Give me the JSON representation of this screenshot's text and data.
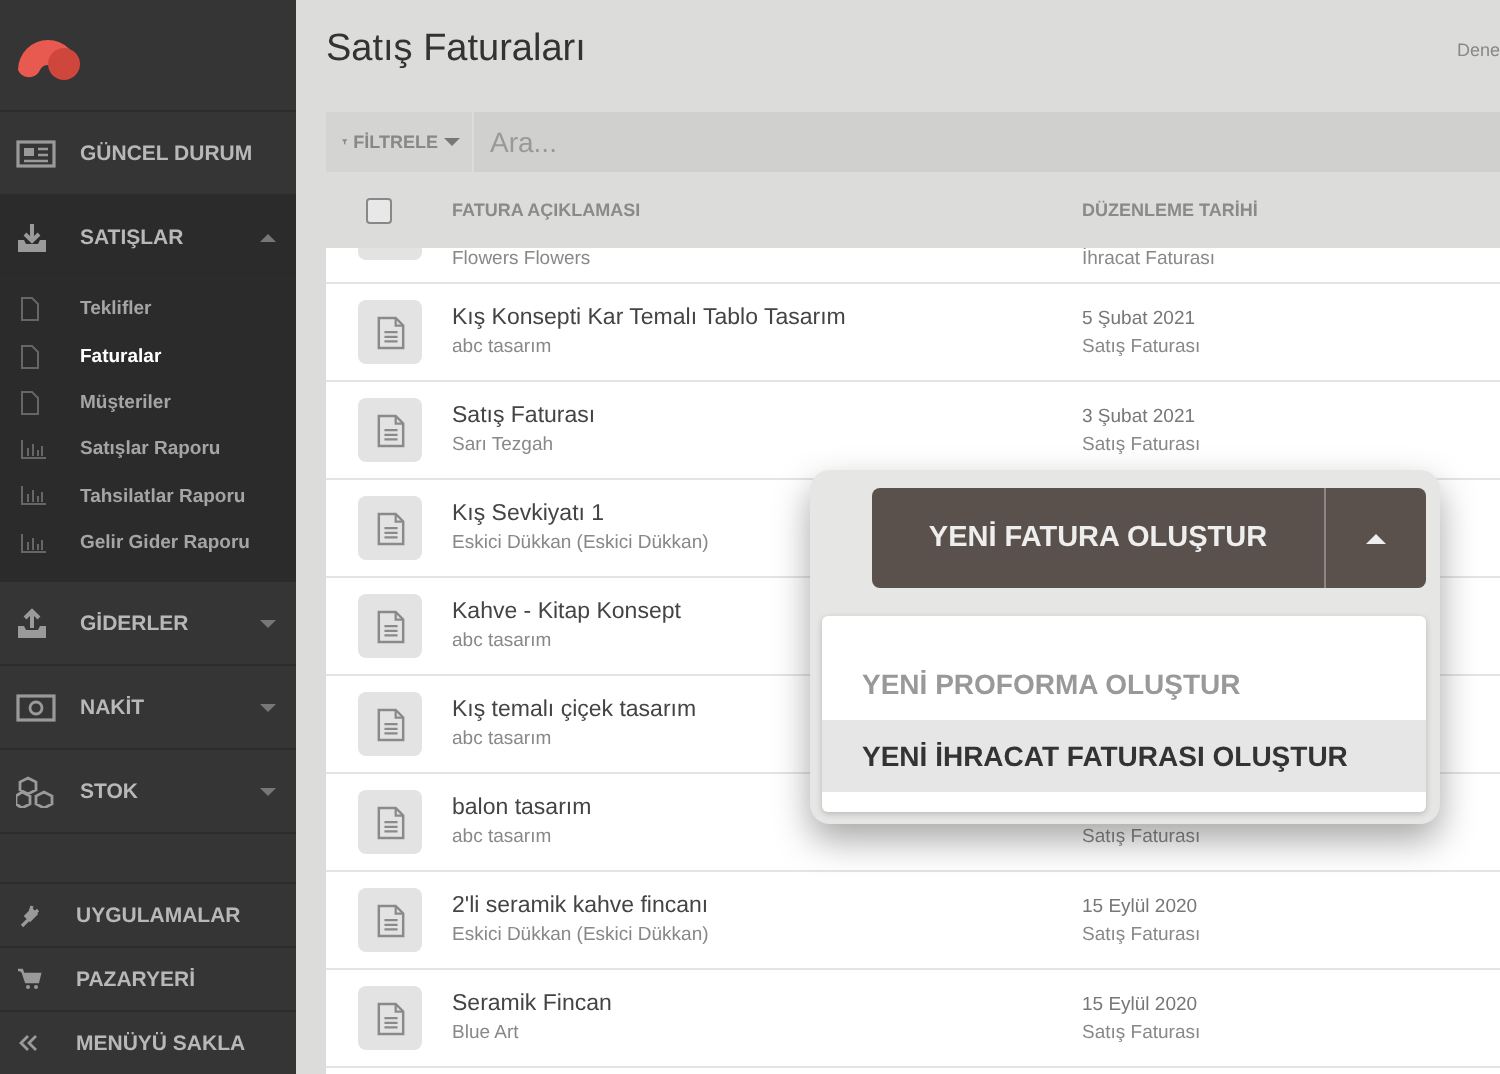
{
  "sidebar": {
    "items": [
      {
        "label": "GÜNCEL DURUM",
        "kind": "link"
      },
      {
        "label": "SATIŞLAR",
        "kind": "group",
        "expanded": true,
        "children": [
          {
            "label": "Teklifler",
            "selected": false
          },
          {
            "label": "Faturalar",
            "selected": true
          },
          {
            "label": "Müşteriler",
            "selected": false
          },
          {
            "label": "Satışlar Raporu",
            "selected": false
          },
          {
            "label": "Tahsilatlar Raporu",
            "selected": false
          },
          {
            "label": "Gelir Gider Raporu",
            "selected": false
          }
        ]
      },
      {
        "label": "GİDERLER",
        "kind": "group",
        "expanded": false
      },
      {
        "label": "NAKİT",
        "kind": "group",
        "expanded": false
      },
      {
        "label": "STOK",
        "kind": "group",
        "expanded": false
      }
    ],
    "bottom_items": [
      "UYGULAMALAR",
      "PAZARYERİ",
      "MENÜYÜ SAKLA"
    ]
  },
  "header": {
    "title": "Satış Faturaları",
    "user_label": "Dene"
  },
  "filter": {
    "button": "FİLTRELE",
    "placeholder": "Ara..."
  },
  "table": {
    "select_all_checked": false,
    "columns": [
      "FATURA AÇIKLAMASI",
      "DÜZENLEME TARİHİ"
    ],
    "rows": [
      {
        "kind": "partial",
        "customer": "Flowers Flowers",
        "type": "İhracat Faturası"
      },
      {
        "kind": "full",
        "description": "Kış Konsepti Kar Temalı Tablo Tasarım",
        "customer": "abc tasarım",
        "date": "5 Şubat 2021",
        "type": "Satış Faturası"
      },
      {
        "kind": "full",
        "description": "Satış Faturası",
        "customer": "Sarı Tezgah",
        "date": "3 Şubat 2021",
        "type": "Satış Faturası"
      },
      {
        "kind": "full",
        "description": "Kış Sevkiyatı 1",
        "customer": "Eskici Dükkan (Eskici Dükkan)"
      },
      {
        "kind": "full",
        "description": "Kahve - Kitap Konsept",
        "customer": "abc tasarım"
      },
      {
        "kind": "full",
        "description": "Kış temalı çiçek tasarım",
        "customer": "abc tasarım"
      },
      {
        "kind": "full",
        "description": "balon tasarım",
        "customer": "abc tasarım",
        "type": "Satış Faturası"
      },
      {
        "kind": "full",
        "description": "2'li seramik kahve fincanı",
        "customer": "Eskici Dükkan (Eskici Dükkan)",
        "date": "15 Eylül 2020",
        "type": "Satış Faturası"
      },
      {
        "kind": "full",
        "description": "Seramik Fincan",
        "customer": "Blue Art",
        "date": "15 Eylül 2020",
        "type": "Satış Faturası"
      }
    ]
  },
  "popup": {
    "primary_button": "YENİ FATURA OLUŞTUR",
    "menu": [
      {
        "label": "YENİ PROFORMA OLUŞTUR",
        "selected": false
      },
      {
        "label": "YENİ İHRACAT FATURASI OLUŞTUR",
        "selected": true
      }
    ]
  }
}
